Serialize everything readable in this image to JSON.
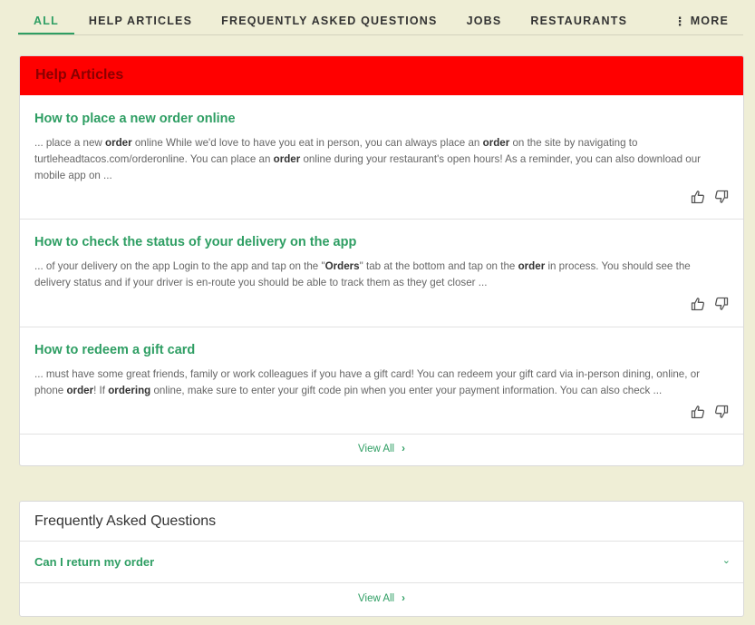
{
  "tabs": {
    "items": [
      "All",
      "Help Articles",
      "Frequently Asked Questions",
      "Jobs",
      "Restaurants"
    ],
    "more_label": "More",
    "active": "All"
  },
  "help_articles": {
    "header": "Help Articles",
    "articles": [
      {
        "title": "How to place a new order online",
        "snippet_parts": [
          "... place a new ",
          "order",
          " online While we'd love to have you eat in person, you can always place an ",
          "order",
          " on the site by navigating to turtleheadtacos.com/orderonline. You can place an ",
          "order",
          " online during your restaurant's open hours! As a reminder, you can also download our mobile app on ..."
        ]
      },
      {
        "title": "How to check the status of your delivery on the app",
        "snippet_parts": [
          "... of your delivery on the app Login to the app and tap on the \"",
          "Orders",
          "\" tab at the bottom and tap on the ",
          "order",
          " in process. You should see the delivery status and if your driver is en-route you should be able to track them as they get closer ..."
        ]
      },
      {
        "title": "How to redeem a gift card",
        "snippet_parts": [
          "... must have some great friends, family or work colleagues if you have a gift card! You can redeem your gift card via in-person dining, online, or phone ",
          "order",
          "! If ",
          "ordering",
          " online, make sure to enter your gift code pin when you enter your payment information. You can also check ..."
        ]
      }
    ],
    "view_all": "View All"
  },
  "faq": {
    "header": "Frequently Asked Questions",
    "questions": [
      "Can I return my order"
    ],
    "view_all": "View All"
  },
  "colors": {
    "accent": "#2e9e63",
    "header_red": "#ff0000",
    "background": "#efeed6"
  }
}
